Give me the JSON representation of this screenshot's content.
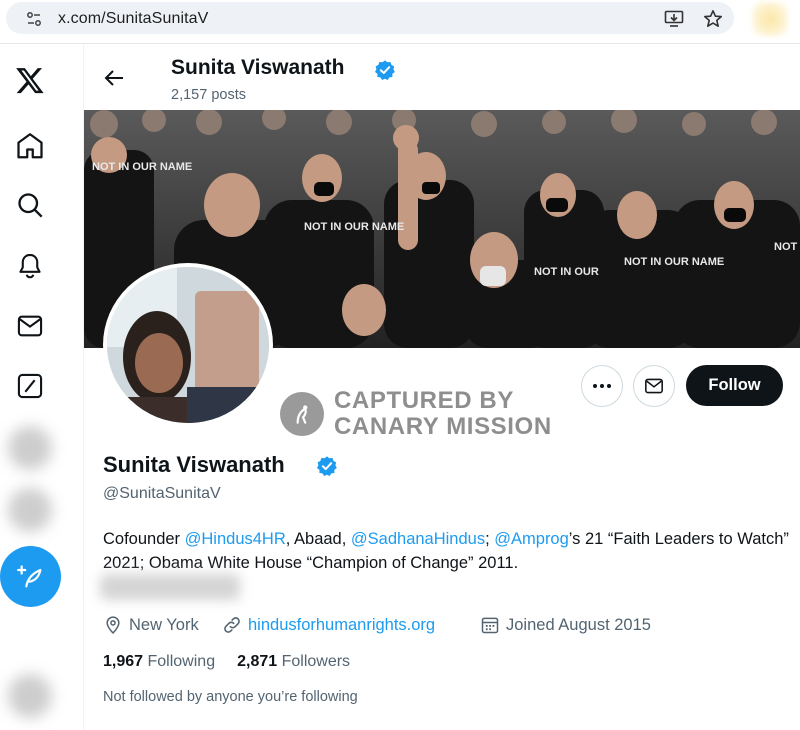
{
  "browser": {
    "url": "x.com/SunitaSunitaV"
  },
  "header": {
    "name": "Sunita Viswanath",
    "posts_count": "2,157 posts"
  },
  "profile": {
    "display_name": "Sunita Viswanath",
    "handle": "@SunitaSunitaV",
    "bio_parts": [
      {
        "text": "Cofounder ",
        "link": false
      },
      {
        "text": "@Hindus4HR",
        "link": true
      },
      {
        "text": ", Abaad, ",
        "link": false
      },
      {
        "text": "@SadhanaHindus",
        "link": true
      },
      {
        "text": "; ",
        "link": false
      },
      {
        "text": "@Amprog",
        "link": true
      },
      {
        "text": "’s 21 “Faith Leaders to Watch” 2021; Obama White House “Champion of Change” 2011.",
        "link": false
      }
    ],
    "location": "New York",
    "website": "hindusforhumanrights.org",
    "joined": "Joined August 2015",
    "following_count": "1,967",
    "following_label": "Following",
    "followers_count": "2,871",
    "followers_label": "Followers",
    "not_followed_text": "Not followed by anyone you’re following"
  },
  "actions": {
    "follow_label": "Follow"
  },
  "banner_signs": [
    "NOT IN OUR NAME",
    "NOT IN OUR NAME",
    "NOT IN OUR",
    "NOT IN OUR NAME",
    "NOT IN OUR NAME"
  ],
  "watermark": {
    "line1": "CAPTURED BY",
    "line2": "CANARY MISSION"
  },
  "colors": {
    "accent": "#1d9bf0",
    "follow_bg": "#0f1419",
    "secondary_text": "#536471"
  }
}
